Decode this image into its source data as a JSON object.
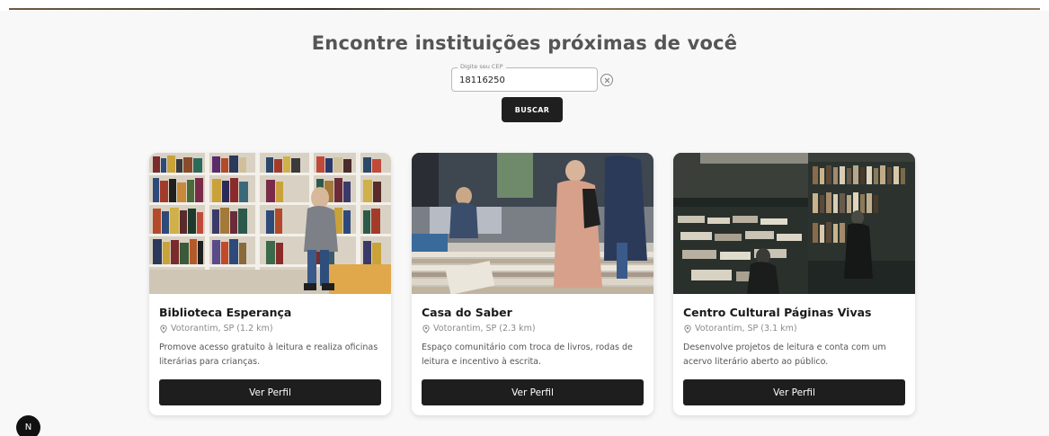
{
  "header": {
    "title": "Encontre instituições próximas de você"
  },
  "search": {
    "label": "Digite seu CEP",
    "value": "18116250",
    "clear_icon": "close-circle-icon",
    "button_label": "BUSCAR"
  },
  "cards": [
    {
      "name": "Biblioteca Esperança",
      "location": "Votorantim, SP (1.2 km)",
      "description": "Promove acesso gratuito à leitura e realiza oficinas literárias para crianças.",
      "button_label": "Ver Perfil"
    },
    {
      "name": "Casa do Saber",
      "location": "Votorantim, SP (2.3 km)",
      "description": "Espaço comunitário com troca de livros, rodas de leitura e incentivo à escrita.",
      "button_label": "Ver Perfil"
    },
    {
      "name": "Centro Cultural Páginas Vivas",
      "location": "Votorantim, SP (3.1 km)",
      "description": "Desenvolve projetos de leitura e conta com um acervo literário aberto ao público.",
      "button_label": "Ver Perfil"
    }
  ],
  "badge": {
    "letter": "N"
  },
  "colors": {
    "button": "#1e1e1e",
    "title": "#555555",
    "background": "#f8f8f8"
  }
}
